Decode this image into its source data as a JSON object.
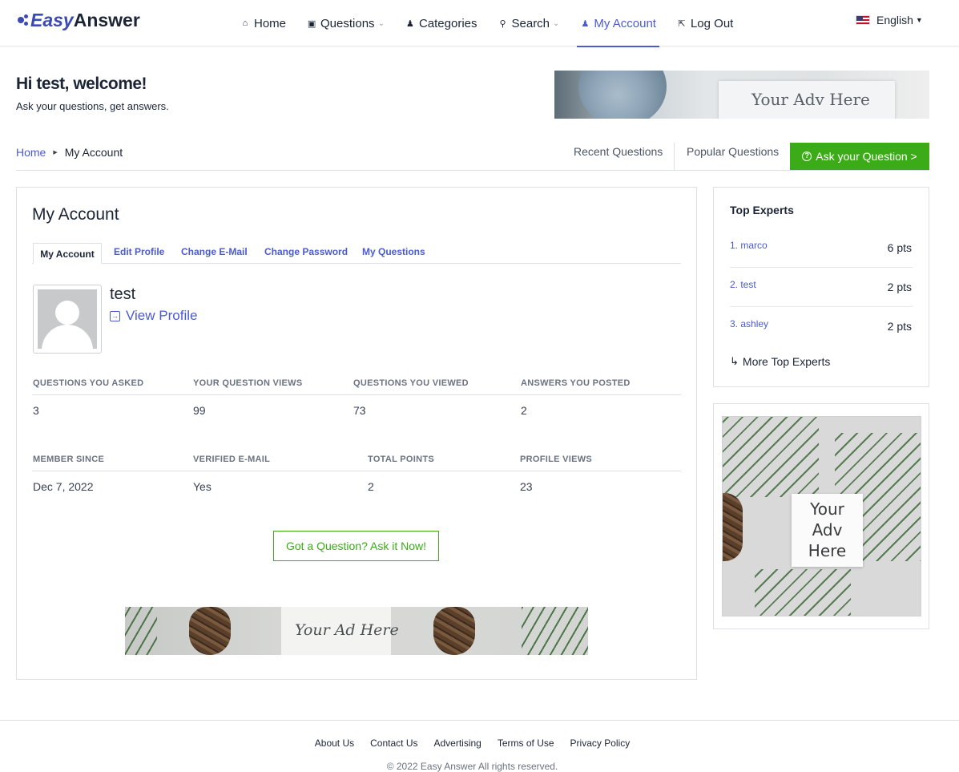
{
  "header": {
    "logo_easy": "Easy",
    "logo_answer": "Answer",
    "nav": [
      {
        "label": "Home",
        "icon": "home-icon",
        "has_caret": false
      },
      {
        "label": "Questions",
        "icon": "question-square-icon",
        "has_caret": true
      },
      {
        "label": "Categories",
        "icon": "user-icon",
        "has_caret": false
      },
      {
        "label": "Search",
        "icon": "search-icon",
        "has_caret": true
      },
      {
        "label": "My Account",
        "icon": "person-icon",
        "has_caret": false,
        "active": true
      },
      {
        "label": "Log Out",
        "icon": "logout-icon",
        "has_caret": false
      }
    ],
    "language": "English"
  },
  "welcome": {
    "title": "Hi test, welcome!",
    "subtitle": "Ask your questions, get answers."
  },
  "ads": {
    "top": "Your Adv Here",
    "bottom": "Your Ad Here",
    "side_line1": "Your",
    "side_line2": "Adv",
    "side_line3": "Here"
  },
  "breadcrumb": {
    "home": "Home",
    "current": "My Account"
  },
  "question_tabs": {
    "recent": "Recent Questions",
    "popular": "Popular Questions",
    "ask_button": "Ask your Question >"
  },
  "account": {
    "title": "My Account",
    "tabs": [
      "My Account",
      "Edit Profile",
      "Change E-Mail",
      "Change Password",
      "My Questions"
    ],
    "username": "test",
    "view_profile": "View Profile",
    "stats_row1": {
      "labels": [
        "QUESTIONS YOU ASKED",
        "YOUR QUESTION VIEWS",
        "QUESTIONS YOU VIEWED",
        "ANSWERS YOU POSTED"
      ],
      "values": [
        "3",
        "99",
        "73",
        "2"
      ]
    },
    "stats_row2": {
      "labels": [
        "MEMBER SINCE",
        "VERIFIED E-MAIL",
        "TOTAL POINTS",
        "PROFILE VIEWS"
      ],
      "values": [
        "Dec 7, 2022",
        "Yes",
        "2",
        "23"
      ]
    },
    "ask_now_button": "Got a Question? Ask it Now!"
  },
  "top_experts": {
    "title": "Top Experts",
    "experts": [
      {
        "name": "1. marco",
        "points": "6 pts"
      },
      {
        "name": "2. test",
        "points": "2 pts"
      },
      {
        "name": "3. ashley",
        "points": "2 pts"
      }
    ],
    "more": "More Top Experts"
  },
  "footer": {
    "links": [
      "About Us",
      "Contact Us",
      "Advertising",
      "Terms of Use",
      "Privacy Policy"
    ],
    "copyright": "© 2022 Easy Answer All rights reserved."
  },
  "colors": {
    "brand": "#3b4bb3",
    "accent": "#4a5bd0",
    "green": "#3bab17"
  }
}
